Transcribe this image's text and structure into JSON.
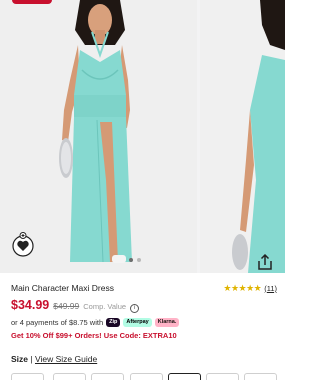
{
  "product": {
    "title": "Main Character Maxi Dress",
    "price": "$34.99",
    "compare_price": "$49.99",
    "compare_label": "Comp. Value",
    "rating": {
      "stars": "★★★★★",
      "count": "(11)"
    },
    "installments": {
      "text": "or 4 payments of $8.75 with",
      "providers": [
        "Zip",
        "Afterpay",
        "Klarna."
      ]
    },
    "promo": "Get 10% Off $99+ Orders! Use Code: EXTRA10"
  },
  "size": {
    "label": "Size",
    "separator": "|",
    "guide_label": "View Size Guide"
  },
  "gallery": {
    "dress_color": "#86d9d0",
    "accent_color": "#c8102e"
  }
}
